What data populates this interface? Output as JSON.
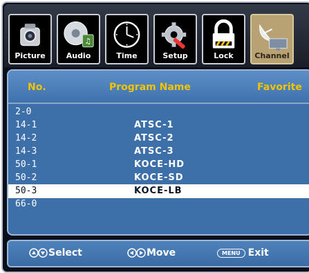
{
  "menu": {
    "tabs": [
      {
        "label": "Picture"
      },
      {
        "label": "Audio"
      },
      {
        "label": "Time"
      },
      {
        "label": "Setup"
      },
      {
        "label": "Lock"
      },
      {
        "label": "Channel"
      }
    ],
    "active_tab": "Channel"
  },
  "table": {
    "headers": {
      "no": "No.",
      "name": "Program Name",
      "favorite": "Favorite"
    },
    "rows": [
      {
        "no": "2-0",
        "name": ""
      },
      {
        "no": "14-1",
        "name": "ATSC-1"
      },
      {
        "no": "14-2",
        "name": "ATSC-2"
      },
      {
        "no": "14-3",
        "name": "ATSC-3"
      },
      {
        "no": "50-1",
        "name": "KOCE-HD"
      },
      {
        "no": "50-2",
        "name": "KOCE-SD"
      },
      {
        "no": "50-3",
        "name": "KOCE-LB"
      },
      {
        "no": "66-0",
        "name": ""
      }
    ],
    "selected_row": "50-3"
  },
  "footer": {
    "select_label": "Select",
    "move_label": "Move",
    "menu_key": "MENU",
    "exit_label": "Exit"
  },
  "colors": {
    "header_text": "#f1c400",
    "panel_bg": "#3d6fa8",
    "active_tab": "#b8a274"
  }
}
